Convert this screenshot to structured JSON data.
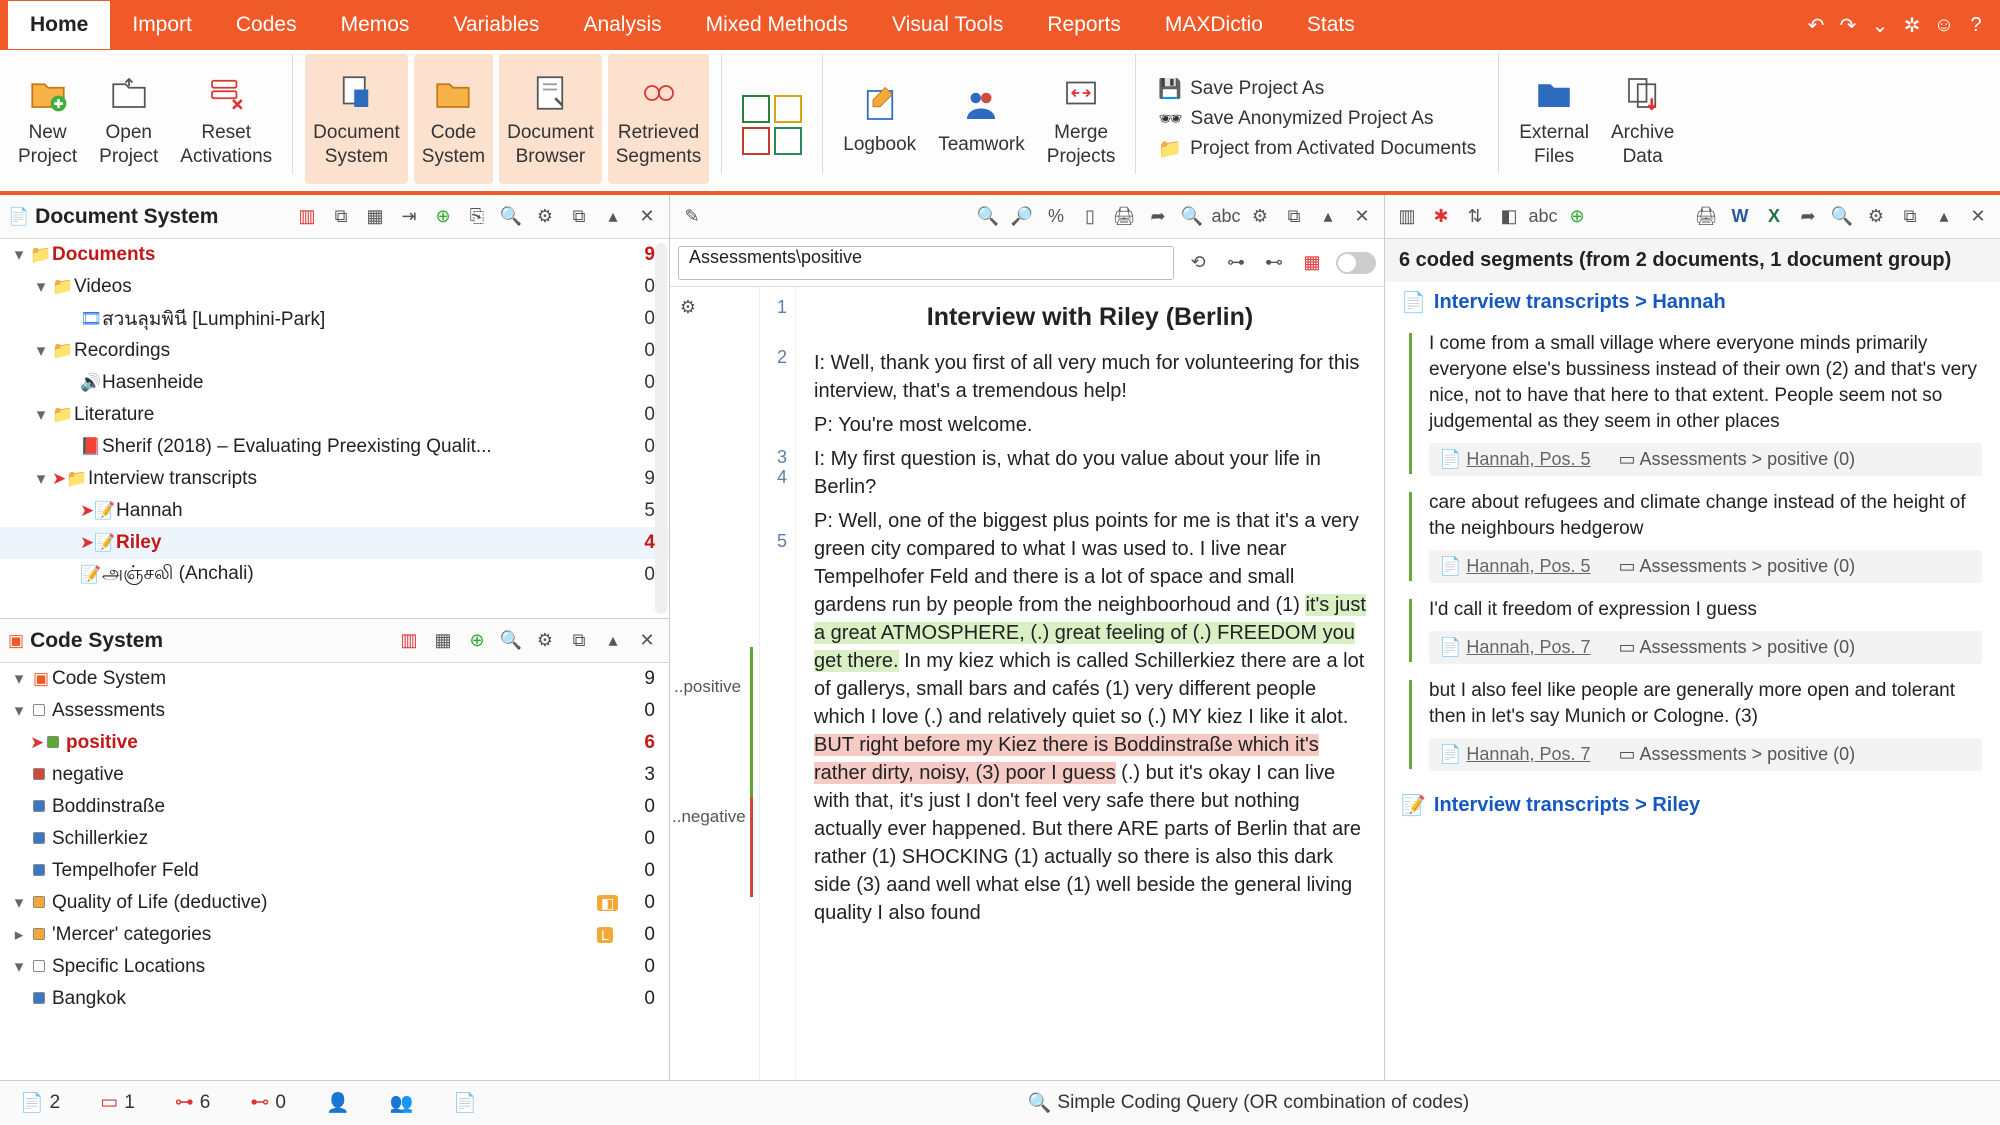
{
  "menubar": {
    "tabs": [
      "Home",
      "Import",
      "Codes",
      "Memos",
      "Variables",
      "Analysis",
      "Mixed Methods",
      "Visual Tools",
      "Reports",
      "MAXDictio",
      "Stats"
    ],
    "active_index": 0
  },
  "ribbon": {
    "groups": [
      {
        "label": "New\nProject",
        "icon": "new-project-icon"
      },
      {
        "label": "Open\nProject",
        "icon": "open-project-icon",
        "dropdown": true
      },
      {
        "label": "Reset\nActivations",
        "icon": "reset-icon"
      },
      {
        "label": "Document\nSystem",
        "icon": "doc-system-icon",
        "hl": true
      },
      {
        "label": "Code\nSystem",
        "icon": "code-system-icon",
        "hl": true
      },
      {
        "label": "Document\nBrowser",
        "icon": "doc-browser-icon",
        "hl": true
      },
      {
        "label": "Retrieved\nSegments",
        "icon": "retrieved-icon",
        "hl": true
      },
      {
        "label": "",
        "icon": "overview-grid-icon"
      },
      {
        "label": "Logbook",
        "icon": "logbook-icon"
      },
      {
        "label": "Teamwork",
        "icon": "teamwork-icon",
        "dropdown": true
      },
      {
        "label": "Merge\nProjects",
        "icon": "merge-icon"
      }
    ],
    "project_actions": [
      "Save Project As",
      "Save Anonymized Project As",
      "Project from Activated Documents"
    ],
    "right_groups": [
      {
        "label": "External\nFiles",
        "icon": "external-files-icon",
        "dropdown": true
      },
      {
        "label": "Archive\nData",
        "icon": "archive-data-icon"
      }
    ]
  },
  "doc_system": {
    "title": "Document System",
    "rows": [
      {
        "indent": 0,
        "expand": "▾",
        "type": "folder",
        "name": "Documents",
        "count": 9,
        "bold": true
      },
      {
        "indent": 1,
        "expand": "▾",
        "type": "folder",
        "name": "Videos",
        "count": 0
      },
      {
        "indent": 2,
        "expand": "",
        "type": "video",
        "name": "สวนลุมพินี [Lumphini-Park]",
        "count": 0
      },
      {
        "indent": 1,
        "expand": "▾",
        "type": "folder",
        "name": "Recordings",
        "count": 0
      },
      {
        "indent": 2,
        "expand": "",
        "type": "audio",
        "name": "Hasenheide",
        "count": 0
      },
      {
        "indent": 1,
        "expand": "▾",
        "type": "folder",
        "name": "Literature",
        "count": 0
      },
      {
        "indent": 2,
        "expand": "",
        "type": "pdf",
        "name": "Sherif (2018) – Evaluating Preexisting Qualit...",
        "count": 0
      },
      {
        "indent": 1,
        "expand": "▾",
        "type": "folder",
        "name": "Interview transcripts",
        "count": 9,
        "arrow": true
      },
      {
        "indent": 2,
        "expand": "",
        "type": "text",
        "name": "Hannah",
        "count": 5,
        "arrow": true
      },
      {
        "indent": 2,
        "expand": "",
        "type": "text",
        "name": "Riley",
        "count": 4,
        "bold": true,
        "arrow": true,
        "sel": true
      },
      {
        "indent": 2,
        "expand": "",
        "type": "text",
        "name": "அஞ்சலி (Anchali)",
        "count": 0
      }
    ]
  },
  "code_system": {
    "title": "Code System",
    "rows": [
      {
        "indent": 0,
        "expand": "▾",
        "name": "Code System",
        "count": 9,
        "root": true
      },
      {
        "indent": 1,
        "expand": "▾",
        "name": "Assessments",
        "count": 0,
        "color": "#ffffff"
      },
      {
        "indent": 2,
        "expand": "",
        "name": "positive",
        "count": 6,
        "color": "#5da733",
        "active": true,
        "arrow": true
      },
      {
        "indent": 2,
        "expand": "",
        "name": "negative",
        "count": 3,
        "color": "#d04a3a"
      },
      {
        "indent": 1,
        "expand": "",
        "name": "Boddinstraße",
        "count": 0,
        "color": "#3b78c3"
      },
      {
        "indent": 1,
        "expand": "",
        "name": "Schillerkiez",
        "count": 0,
        "color": "#3b78c3"
      },
      {
        "indent": 1,
        "expand": "",
        "name": "Tempelhofer Feld",
        "count": 0,
        "color": "#3b78c3"
      },
      {
        "indent": 1,
        "expand": "▾",
        "name": "Quality of Life (deductive)",
        "count": 0,
        "color": "#f3a938",
        "badge": "◧"
      },
      {
        "indent": 2,
        "expand": "▸",
        "name": "'Mercer' categories",
        "count": 0,
        "color": "#f3a938",
        "badge": "L"
      },
      {
        "indent": 1,
        "expand": "▾",
        "name": "Specific Locations",
        "count": 0,
        "color": "#ffffff"
      },
      {
        "indent": 2,
        "expand": "",
        "name": "Bangkok",
        "count": 0,
        "color": "#3b78c3"
      }
    ]
  },
  "doc_browser": {
    "path": "Assessments\\positive",
    "title": "Interview with Riley (Berlin)",
    "line_numbers": [
      1,
      2,
      3,
      4,
      5
    ],
    "code_label_pos": "..positive",
    "code_label_neg": "..negative",
    "p1": "I: Well, thank you first of all very much for volunteering for this interview, that's a tremendous help!",
    "p2": "P: You're most welcome.",
    "p3": "I: My first question is, what do you value about your life in Berlin?",
    "p4a": "P: Well, one of the biggest plus points for me is that it's a very green city compared to what I was used to. I live near Tempelhofer Feld and there is a lot of space and small gardens run by people from the neighboorhoud and (1) ",
    "p4b": "it's just a great ATMOSPHERE, (.) great feeling of (.) FREEDOM you get there.",
    "p4c": " In my kiez which is called Schillerkiez there are a lot of gallerys, small bars and cafés (1) very different people which I love (.) and relatively quiet so (.) MY kiez I like it alot. ",
    "p4d": "BUT right before my Kiez there is Boddinstraße which it's rather dirty, noisy, (3) poor I guess",
    "p4e": " (.) but it's okay I can live with that, it's just I don't feel very safe there but nothing actually ever happened. But there ARE parts of Berlin that are rather (1) SHOCKING (1) actually so there is also this dark side (3) aand well what else (1) well beside the general living quality I also found"
  },
  "retrieved": {
    "summary": "6 coded segments (from 2 documents, 1 document group)",
    "group1": "Interview transcripts > Hannah",
    "group2": "Interview transcripts > Riley",
    "items": [
      {
        "text": "I come from a small village where everyone minds primarily everyone else's bussiness instead of their own (2) and that's very nice, not to have that here to that extent. People seem not so judgemental as they seem in other places",
        "doc": "Hannah, Pos. 5",
        "code": "Assessments > positive (0)"
      },
      {
        "text": "care about refugees and climate change instead of the height of the neighbours hedgerow",
        "doc": "Hannah, Pos. 5",
        "code": "Assessments > positive (0)"
      },
      {
        "text": "I'd call it freedom of expression I guess",
        "doc": "Hannah, Pos. 7",
        "code": "Assessments > positive (0)"
      },
      {
        "text": "but I also feel like people are generally more open and tolerant then in let's say Munich or Cologne. (3)",
        "doc": "Hannah, Pos. 7",
        "code": "Assessments > positive (0)"
      }
    ]
  },
  "status": {
    "docs": "2",
    "codes": "1",
    "seg_green": "6",
    "seg_other": "0",
    "query": "Simple Coding Query (OR combination of codes)"
  }
}
